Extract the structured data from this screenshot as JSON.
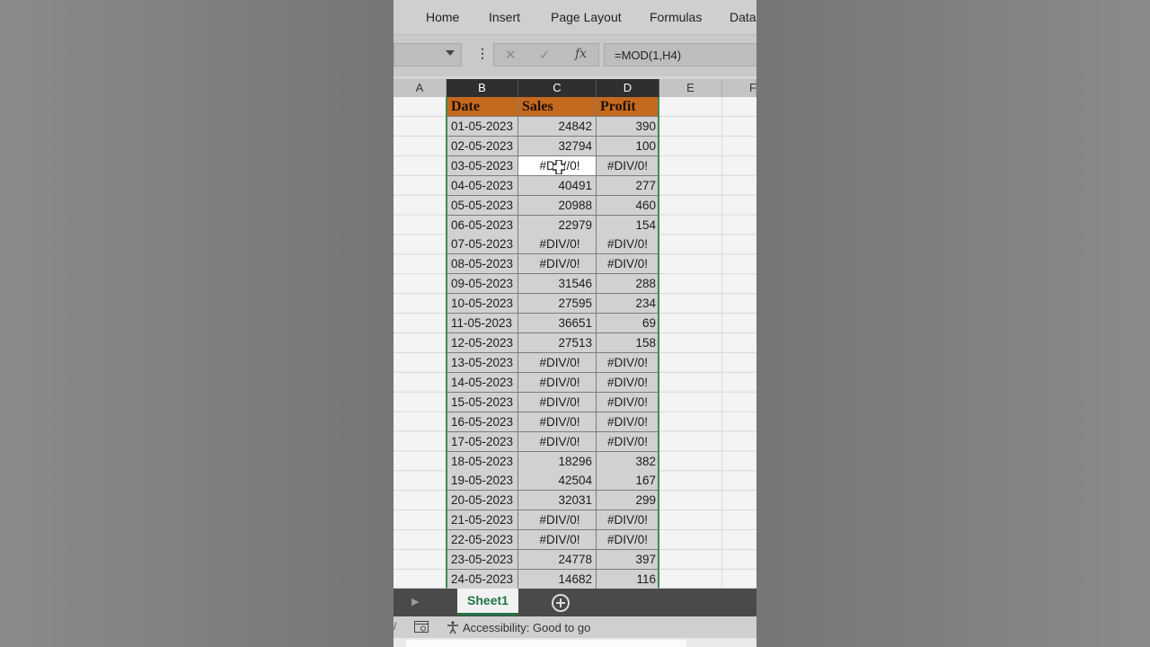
{
  "ribbon": {
    "tabs": [
      "Home",
      "Insert",
      "Page Layout",
      "Formulas",
      "Data"
    ]
  },
  "formula_bar": {
    "cancel_icon": "x-icon",
    "enter_icon": "check-icon",
    "fx_label": "fx",
    "formula": "=MOD(1,H4)"
  },
  "columns": [
    "A",
    "B",
    "C",
    "D",
    "E",
    "F"
  ],
  "table": {
    "headers": [
      "Date",
      "Sales",
      "Profit"
    ],
    "rows": [
      [
        "01-05-2023",
        "24842",
        "390"
      ],
      [
        "02-05-2023",
        "32794",
        "100"
      ],
      [
        "03-05-2023",
        "#DIV/0!",
        "#DIV/0!"
      ],
      [
        "04-05-2023",
        "40491",
        "277"
      ],
      [
        "05-05-2023",
        "20988",
        "460"
      ],
      [
        "06-05-2023",
        "22979",
        "154"
      ],
      [
        "07-05-2023",
        "#DIV/0!",
        "#DIV/0!"
      ],
      [
        "08-05-2023",
        "#DIV/0!",
        "#DIV/0!"
      ],
      [
        "09-05-2023",
        "31546",
        "288"
      ],
      [
        "10-05-2023",
        "27595",
        "234"
      ],
      [
        "11-05-2023",
        "36651",
        "69"
      ],
      [
        "12-05-2023",
        "27513",
        "158"
      ],
      [
        "13-05-2023",
        "#DIV/0!",
        "#DIV/0!"
      ],
      [
        "14-05-2023",
        "#DIV/0!",
        "#DIV/0!"
      ],
      [
        "15-05-2023",
        "#DIV/0!",
        "#DIV/0!"
      ],
      [
        "16-05-2023",
        "#DIV/0!",
        "#DIV/0!"
      ],
      [
        "17-05-2023",
        "#DIV/0!",
        "#DIV/0!"
      ],
      [
        "18-05-2023",
        "18296",
        "382"
      ],
      [
        "19-05-2023",
        "42504",
        "167"
      ],
      [
        "20-05-2023",
        "32031",
        "299"
      ],
      [
        "21-05-2023",
        "#DIV/0!",
        "#DIV/0!"
      ],
      [
        "22-05-2023",
        "#DIV/0!",
        "#DIV/0!"
      ],
      [
        "23-05-2023",
        "24778",
        "397"
      ],
      [
        "24-05-2023",
        "14682",
        "116"
      ]
    ]
  },
  "sheet_tabs": {
    "active": "Sheet1"
  },
  "status": {
    "accessibility": "Accessibility: Good to go"
  },
  "colors": {
    "header_fill": "#c5691f",
    "selection": "#3e8a55",
    "sheet_tab_text": "#217346"
  }
}
